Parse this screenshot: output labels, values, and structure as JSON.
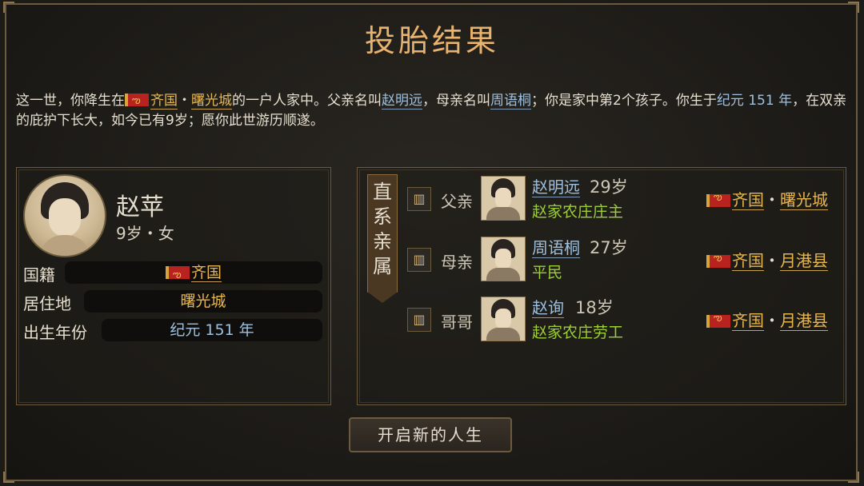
{
  "title": "投胎结果",
  "intro": {
    "p1": "这一世，你降生在",
    "country": "齐国",
    "dot": "・",
    "city": "曙光城",
    "p2": "的一户人家中。父亲名叫",
    "father": "赵明远",
    "p3": "，母亲名叫",
    "mother": "周语桐",
    "p4": "；你是家中第2个孩子。你生于",
    "era": "纪元 151 年",
    "p5": "，在双亲的庇护下长大，如今已有9岁；愿你此世游历顺遂。"
  },
  "profile": {
    "name": "赵苹",
    "subtitle": "9岁・女",
    "nationality_label": "国籍",
    "nationality_value": "齐国",
    "residence_label": "居住地",
    "residence_value": "曙光城",
    "birth_label": "出生年份",
    "birth_value": "纪元 151 年"
  },
  "relatives": {
    "banner": "直系亲属",
    "items": [
      {
        "icon": "𝌆",
        "role": "父亲",
        "name": "赵明远",
        "age": "29岁",
        "job": "赵家农庄庄主",
        "country": "齐国",
        "dot": "・",
        "place": "曙光城"
      },
      {
        "icon": "𝌆",
        "role": "母亲",
        "name": "周语桐",
        "age": "27岁",
        "job": "平民",
        "country": "齐国",
        "dot": "・",
        "place": "月港县"
      },
      {
        "icon": "𝌆",
        "role": "哥哥",
        "name": "赵询",
        "age": "18岁",
        "job": "赵家农庄劳工",
        "country": "齐国",
        "dot": "・",
        "place": "月港县"
      }
    ]
  },
  "button": {
    "start": "开启新的人生"
  },
  "colors": {
    "accent": "#e8b36e",
    "gold": "#e8b64f",
    "blue": "#9ec0de",
    "green": "#9ccf35",
    "border": "#6b5a3e"
  }
}
